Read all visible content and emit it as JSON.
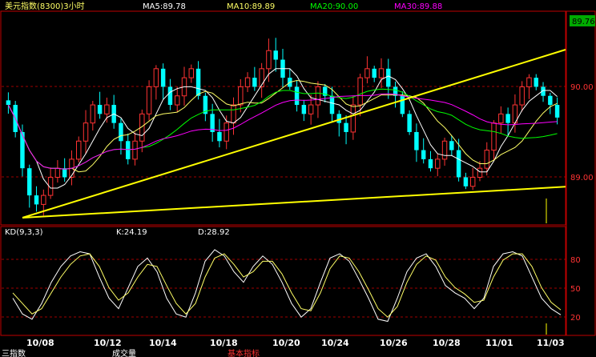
{
  "header": {
    "title": "美元指数(8300)3小时",
    "ma5": "MA5:89.78",
    "ma10": "MA10:89.89",
    "ma20": "MA20:90.00",
    "ma30": "MA30:89.88",
    "last_price": "89.76"
  },
  "kd_header": {
    "label": "KD(9,3,3)",
    "k": "K:24.19",
    "d": "D:28.92"
  },
  "bottom_bar": {
    "item1": "三指数",
    "item2": "成交量",
    "item3": "基本指标"
  },
  "colors": {
    "background": "#000000",
    "frame": "#c00000",
    "up_candle": "#ff3333",
    "down_candle": "#00ffff",
    "ma5": "#ffffff",
    "ma10": "#ffff66",
    "ma20": "#00ff00",
    "ma30": "#ff00ff",
    "trendline": "#ffff00",
    "k_line": "#ffffff",
    "d_line": "#ffff66"
  },
  "chart_data": [
    {
      "type": "candlestick",
      "title": "美元指数(8300)3小时",
      "y_ticks": [
        "90.00",
        "89.00"
      ],
      "ylim": [
        88.6,
        90.9
      ],
      "x_ticks": [
        "10/08",
        "10/12",
        "10/14",
        "10/18",
        "10/20",
        "10/24",
        "10/26",
        "10/28",
        "11/01",
        "11/03"
      ],
      "grid": true,
      "close_approx": [
        89.9,
        89.6,
        89.2,
        88.9,
        88.8,
        88.9,
        89.1,
        89.2,
        89.1,
        89.3,
        89.5,
        89.7,
        89.9,
        89.8,
        89.9,
        89.7,
        89.5,
        89.3,
        89.5,
        89.8,
        90.1,
        90.3,
        90.1,
        89.9,
        90.0,
        90.2,
        90.3,
        90.0,
        89.8,
        89.6,
        89.5,
        89.7,
        89.9,
        90.1,
        90.2,
        90.1,
        90.3,
        90.5,
        90.4,
        90.2,
        90.1,
        89.9,
        89.8,
        89.9,
        90.1,
        90.0,
        89.8,
        89.7,
        89.6,
        89.9,
        90.2,
        90.3,
        90.2,
        90.3,
        90.1,
        90.0,
        89.8,
        89.6,
        89.4,
        89.3,
        89.2,
        89.3,
        89.5,
        89.4,
        89.1,
        89.0,
        89.1,
        89.2,
        89.4,
        89.7,
        89.8,
        89.7,
        89.9,
        90.1,
        90.2,
        90.1,
        90.0,
        89.9,
        89.76
      ]
    },
    {
      "type": "line",
      "title": "KD(9,3,3)",
      "y_ticks": [
        "80",
        "50",
        "20"
      ],
      "ylim": [
        10,
        95
      ],
      "series": [
        {
          "name": "K",
          "values": [
            40,
            25,
            20,
            35,
            55,
            70,
            80,
            84,
            82,
            60,
            40,
            30,
            50,
            70,
            78,
            65,
            40,
            25,
            22,
            45,
            75,
            86,
            80,
            65,
            55,
            70,
            80,
            72,
            55,
            35,
            22,
            30,
            55,
            78,
            82,
            75,
            58,
            40,
            20,
            18,
            40,
            65,
            78,
            82,
            70,
            52,
            45,
            40,
            30,
            40,
            70,
            82,
            84,
            80,
            60,
            40,
            30,
            24.19
          ]
        },
        {
          "name": "D",
          "values": [
            45,
            35,
            25,
            30,
            45,
            60,
            72,
            80,
            82,
            70,
            50,
            38,
            45,
            60,
            72,
            70,
            52,
            35,
            25,
            35,
            60,
            78,
            82,
            72,
            60,
            65,
            75,
            75,
            63,
            45,
            30,
            28,
            45,
            68,
            80,
            78,
            65,
            48,
            30,
            22,
            32,
            55,
            72,
            80,
            76,
            60,
            50,
            44,
            36,
            38,
            60,
            76,
            82,
            82,
            70,
            50,
            36,
            28.92
          ]
        }
      ]
    }
  ]
}
